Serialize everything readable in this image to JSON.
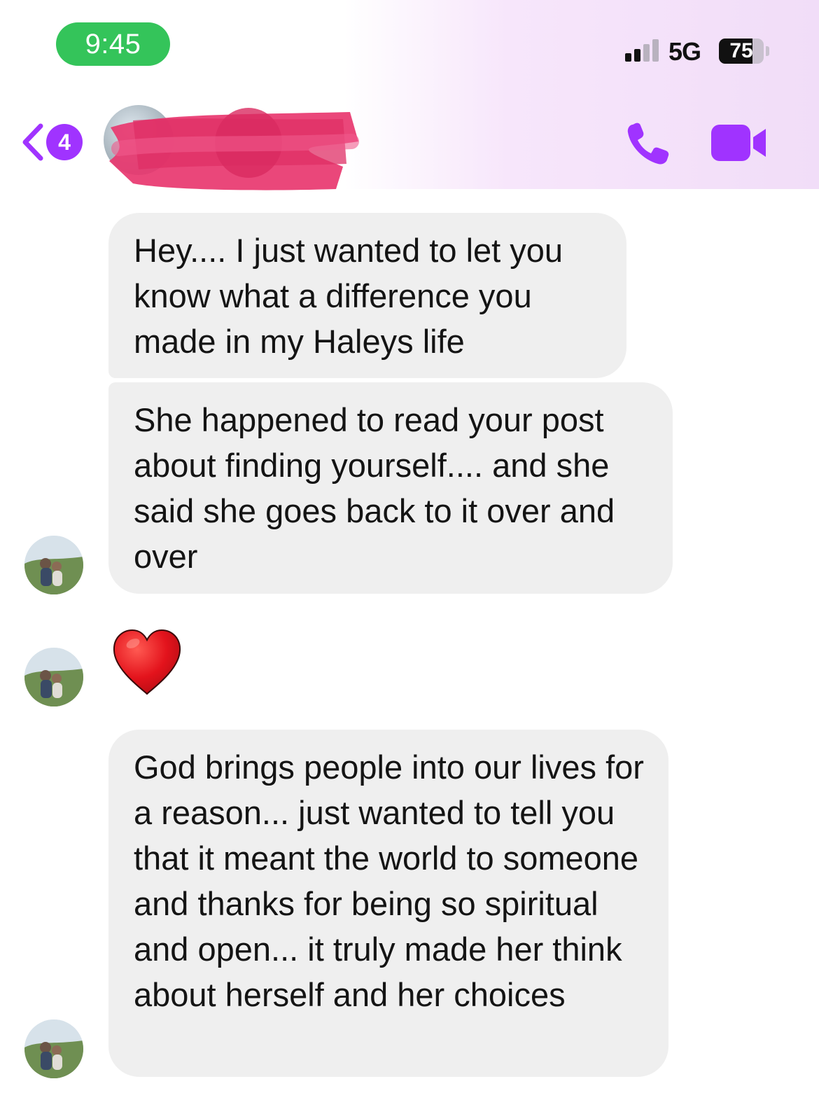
{
  "status_bar": {
    "time": "9:45",
    "network": "5G",
    "battery_percent": 75,
    "battery_label": "75",
    "signal_bars_active": 2,
    "signal_bars_total": 4
  },
  "header": {
    "unread_count": "4",
    "back_icon": "chevron-left-icon",
    "call_icon": "phone-icon",
    "video_icon": "video-camera-icon",
    "accent_color": "#a033ff"
  },
  "messages": [
    {
      "type": "text",
      "text": "Hey.... I just wanted to let you know what a difference you made in my Haleys life"
    },
    {
      "type": "text",
      "text": "She happened to read your post about finding yourself.... and she said she goes back to it over and over"
    },
    {
      "type": "emoji",
      "text": "❤️",
      "icon": "red-heart-icon"
    },
    {
      "type": "text",
      "text": "God brings people into our lives for a reason... just wanted to tell you that it meant the world to someone and thanks for being so spiritual and open... it truly made her think about herself and her choices"
    }
  ],
  "colors": {
    "bubble_background": "#efefef",
    "time_pill": "#34c45a",
    "redaction": "#e8376f"
  }
}
